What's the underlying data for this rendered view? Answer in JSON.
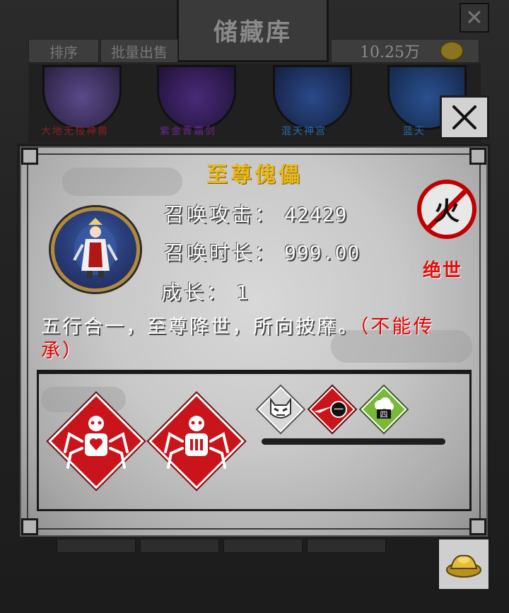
{
  "background": {
    "title": "储藏库",
    "close_symbol": "✕",
    "tabs": [
      "排序",
      "批量出售"
    ],
    "money": "10.25万",
    "currency_icon": "gold-ingot-icon",
    "categories": [
      "大地无极神兽",
      "紫金青霜剑",
      "混天神宫",
      "蓝天"
    ]
  },
  "popup": {
    "close_symbol": "✕",
    "item_name": "至尊傀儡",
    "portrait_icon": "puppet-portrait-icon",
    "stats": {
      "attack_label": "召唤攻击",
      "attack_value": "42429",
      "duration_label": "召唤时长",
      "duration_value": "999.00",
      "growth_label": "成长",
      "growth_value": "1",
      "separator": "："
    },
    "element": {
      "glyph": "火",
      "icon": "no-fire-element-icon",
      "color": "#c00000"
    },
    "rarity": "绝世",
    "description": "五行合一，至尊降世，所向披靡。",
    "description_note": "（不能传承）",
    "skills_large": [
      {
        "icon": "spider-heart-icon",
        "color": "#c8141a"
      },
      {
        "icon": "spider-bars-icon",
        "color": "#c8141a"
      }
    ],
    "skills_small": [
      {
        "icon": "demon-face-icon",
        "color": "#d8d8d8",
        "glyph": "☻"
      },
      {
        "icon": "slash-one-icon",
        "color": "#c8141a",
        "glyph": "一"
      },
      {
        "icon": "bush-four-icon",
        "color": "#7ab83a",
        "glyph": "四"
      }
    ]
  }
}
